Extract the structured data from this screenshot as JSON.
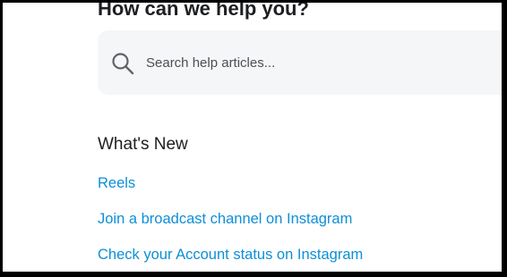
{
  "header": {
    "title": "How can we help you?"
  },
  "search": {
    "placeholder": "Search help articles...",
    "icon": "search-icon"
  },
  "whats_new": {
    "title": "What's New",
    "links": [
      "Reels",
      "Join a broadcast channel on Instagram",
      "Check your Account status on Instagram"
    ]
  },
  "colors": {
    "link": "#0d8fd8",
    "text": "#1c1e21",
    "search_background": "#f5f6f7",
    "frame": "#000000"
  }
}
